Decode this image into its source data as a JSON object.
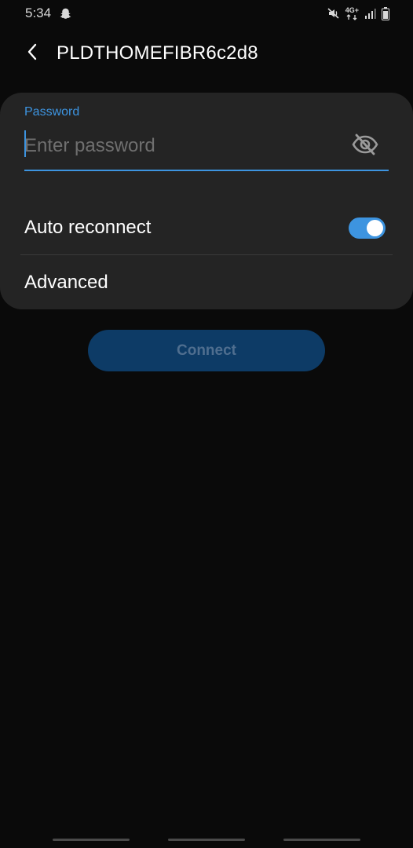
{
  "status_bar": {
    "time": "5:34",
    "network_type": "4G+",
    "icons": [
      "snapchat-icon",
      "mute-icon",
      "network-4g-icon",
      "signal-icon",
      "battery-icon"
    ]
  },
  "header": {
    "back_icon": "chevron-left-icon",
    "title": "PLDTHOMEFIBR6c2d8"
  },
  "password": {
    "label": "Password",
    "value": "",
    "placeholder": "Enter password",
    "visibility_icon": "eye-off-icon"
  },
  "auto_reconnect": {
    "label": "Auto reconnect",
    "enabled": true
  },
  "advanced": {
    "label": "Advanced"
  },
  "connect_button": {
    "label": "Connect",
    "enabled": false
  },
  "colors": {
    "background": "#0a0a0a",
    "card": "#242424",
    "accent": "#3d94e0",
    "button_disabled_bg": "#0d3b66",
    "button_disabled_text": "#4f6e8f"
  }
}
